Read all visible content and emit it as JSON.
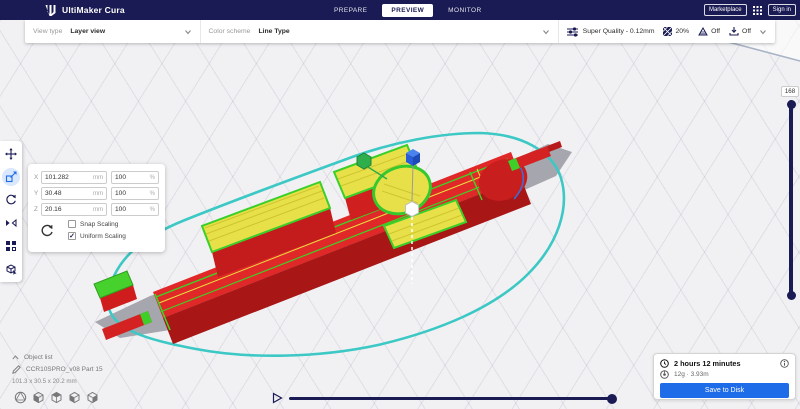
{
  "header": {
    "app_title": "UltiMaker Cura",
    "tabs": [
      {
        "label": "PREPARE"
      },
      {
        "label": "PREVIEW"
      },
      {
        "label": "MONITOR"
      }
    ],
    "active_tab": "PREVIEW",
    "marketplace_label": "Marketplace",
    "sign_in_label": "Sign in"
  },
  "toolbar": {
    "view_type": {
      "label": "View type",
      "value": "Layer view"
    },
    "color_scheme": {
      "label": "Color scheme",
      "value": "Line Type"
    },
    "print_settings": {
      "profile": "Super Quality - 0.12mm",
      "infill_percent": "20%",
      "support": "Off",
      "adhesion": "Off"
    }
  },
  "left_toolbar": {
    "tools": [
      {
        "name": "move"
      },
      {
        "name": "scale",
        "active": true
      },
      {
        "name": "rotate"
      },
      {
        "name": "mirror"
      },
      {
        "name": "per-model-settings"
      },
      {
        "name": "support-blocker"
      }
    ]
  },
  "scale_panel": {
    "rows": [
      {
        "axis": "X",
        "size": "101.282",
        "size_unit": "mm",
        "percent": "100",
        "percent_unit": "%"
      },
      {
        "axis": "Y",
        "size": "30.48",
        "size_unit": "mm",
        "percent": "100",
        "percent_unit": "%"
      },
      {
        "axis": "Z",
        "size": "20.16",
        "size_unit": "mm",
        "percent": "100",
        "percent_unit": "%"
      }
    ],
    "snap_scaling": {
      "label": "Snap Scaling",
      "check_glyph": ""
    },
    "uniform_scaling": {
      "label": "Uniform Scaling",
      "check_glyph": "✓"
    }
  },
  "object_info": {
    "object_list_label": "Object list",
    "file_name": "CCR10SPRO_v08 Part 15",
    "dimensions": "101.3 x 30.5 x 20.2 mm"
  },
  "print_job": {
    "time_estimate": "2 hours 12 minutes",
    "material_estimate": "12g · 3.93m",
    "save_button_label": "Save to Disk"
  },
  "layer_slider": {
    "current_layer": "168"
  },
  "colors": {
    "header_bg": "#1a1a54",
    "accent_blue": "#1f6ce8",
    "brim_cyan": "#3cc8c4",
    "model_red": "#d92222",
    "skin_yellow": "#e8e049",
    "skin_green": "#3ecf28"
  }
}
